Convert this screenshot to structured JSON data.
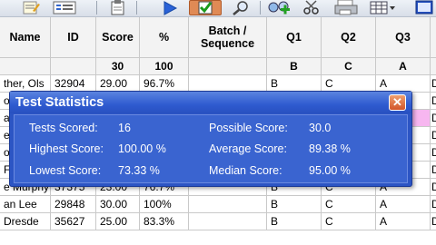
{
  "toolbar": {
    "icons": [
      "notes-icon",
      "list-icon",
      "clipboard-icon",
      "play-icon",
      "check-icon",
      "magnifier-icon",
      "add-node-icon",
      "scissors-icon",
      "printer-icon",
      "table-grid-icon",
      "book-icon"
    ],
    "selected": "check-icon"
  },
  "grid": {
    "columns": [
      "Name",
      "ID",
      "Score",
      "%",
      "Batch / Sequence",
      "Q1",
      "Q2",
      "Q3"
    ],
    "answer_key_row": [
      "",
      "",
      "30",
      "100",
      "",
      "B",
      "C",
      "A"
    ],
    "rows": [
      [
        "ther, Ols",
        "32904",
        "29.00",
        "96.7%",
        "",
        "B",
        "C",
        "A"
      ],
      [
        "or",
        "",
        "",
        "",
        "",
        "",
        "",
        ""
      ],
      [
        "ara",
        "",
        "",
        "",
        "",
        "",
        "",
        ""
      ],
      [
        "e W",
        "",
        "",
        "",
        "",
        "",
        "",
        ""
      ],
      [
        "oria",
        "",
        "",
        "",
        "",
        "",
        "",
        ""
      ],
      [
        "F",
        "",
        "",
        "",
        "",
        "",
        "",
        ""
      ],
      [
        "e Murphy",
        "37375",
        "23.00",
        "76.7%",
        "",
        "B",
        "C",
        "A"
      ],
      [
        "an Lee",
        "29848",
        "30.00",
        "100%",
        "",
        "B",
        "C",
        "A"
      ],
      [
        "Dresde",
        "35627",
        "25.00",
        "83.3%",
        "",
        "B",
        "C",
        "A"
      ]
    ],
    "last_col_fragment": "D"
  },
  "dialog": {
    "title": "Test Statistics",
    "close_glyph": "✕",
    "stats": [
      {
        "label": "Tests Scored:",
        "value": "16"
      },
      {
        "label": "Possible Score:",
        "value": "30.0"
      },
      {
        "label": "Highest Score:",
        "value": "100.00 %"
      },
      {
        "label": "Average Score:",
        "value": "89.38 %"
      },
      {
        "label": "Lowest Score:",
        "value": "73.33 %"
      },
      {
        "label": "Median Score:",
        "value": "95.00 %"
      }
    ]
  },
  "colors": {
    "dialog_blue": "#2c55c4",
    "highlight_pink": "#f7b6f0",
    "selected_tool": "#e08a55"
  }
}
